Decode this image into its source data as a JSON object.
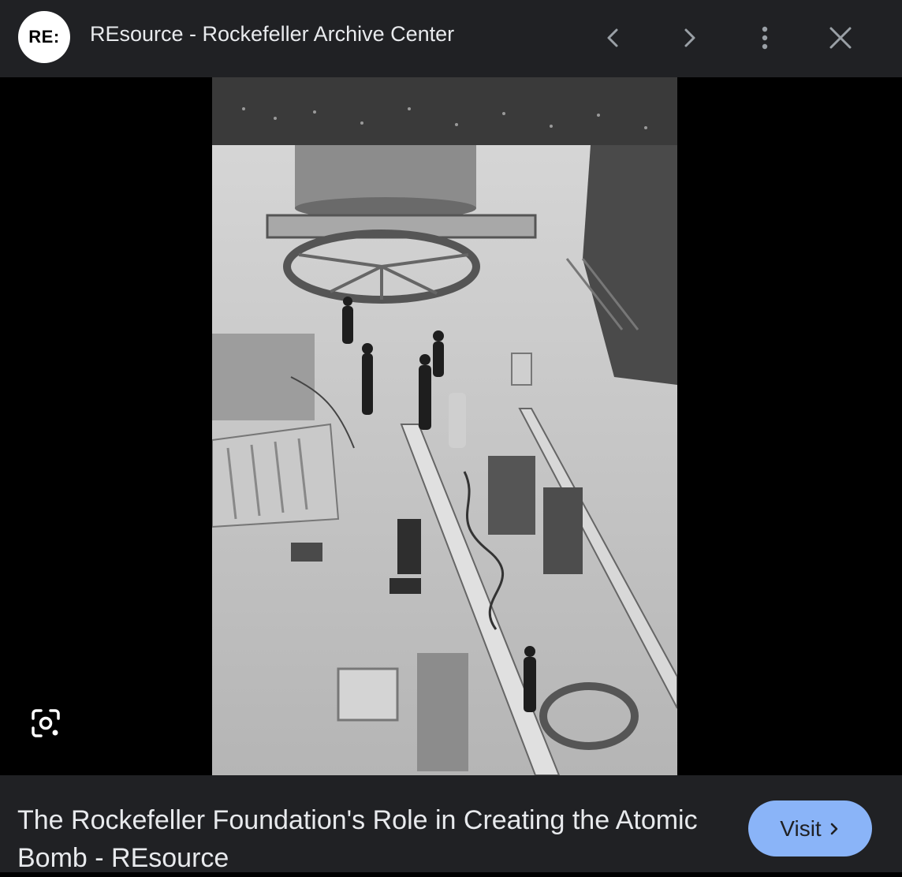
{
  "header": {
    "logo_text": "RE:",
    "site_title": "REsource - Rockefeller Archive Center",
    "icons": [
      "back-icon",
      "forward-icon",
      "more-options-icon",
      "close-icon"
    ]
  },
  "viewer": {
    "lens_icon": "google-lens-icon"
  },
  "footer": {
    "caption": "The Rockefeller Foundation's Role in Creating the Atomic Bomb - REsource",
    "visit_label": "Visit",
    "visit_icon": "chevron-right-icon",
    "accent_color": "#8ab4f8"
  },
  "colors": {
    "bar_bg": "#202124",
    "text": "#e8eaed",
    "viewer_bg": "#000000"
  }
}
